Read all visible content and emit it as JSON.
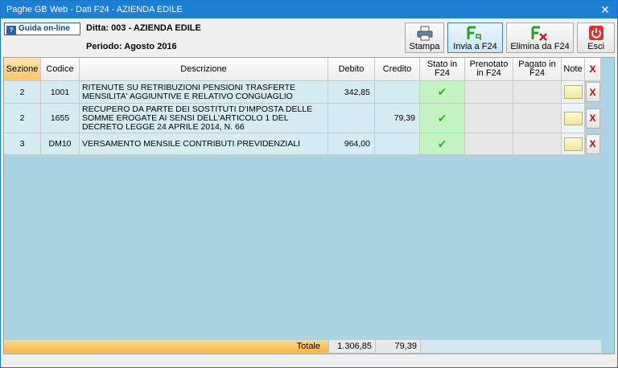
{
  "window": {
    "title": "Paghe GB Web - Dati F24 - AZIENDA EDILE",
    "close_label": "✕"
  },
  "header": {
    "guida_label": "Guida on-line",
    "ditta": "Ditta: 003 - AZIENDA EDILE",
    "periodo": "Periodo: Agosto 2016"
  },
  "toolbar": {
    "stampa": "Stampa",
    "invia": "Invia a F24",
    "elimina": "Elimina da F24",
    "esci": "Esci"
  },
  "table": {
    "columns": {
      "sezione": "Sezione",
      "codice": "Codice",
      "descrizione": "Descrizione",
      "debito": "Debito",
      "credito": "Credito",
      "stato": "Stato in F24",
      "prenotato": "Prenotato in F24",
      "pagato": "Pagato in F24",
      "note": "Note",
      "delete": "X"
    },
    "rows": [
      {
        "sezione": "2",
        "codice": "1001",
        "descrizione": "RITENUTE SU RETRIBUZIONI  PENSIONI TRASFERTE MENSILITA' AGGIUNTIVE E RELATIVO CONGUAGLIO",
        "debito": "342,85",
        "credito": "",
        "stato": "✔"
      },
      {
        "sezione": "2",
        "codice": "1655",
        "descrizione": "RECUPERO DA PARTE DEI SOSTITUTI D'IMPOSTA DELLE SOMME EROGATE AI SENSI DELL'ARTICOLO 1 DEL DECRETO LEGGE 24 APRILE 2014, N. 66",
        "debito": "",
        "credito": "79,39",
        "stato": "✔"
      },
      {
        "sezione": "3",
        "codice": "DM10",
        "descrizione": "VERSAMENTO MENSILE CONTRIBUTI PREVIDENZIALI",
        "debito": "964,00",
        "credito": "",
        "stato": "✔"
      }
    ],
    "delete_label": "X",
    "totals": {
      "label": "Totale",
      "debito": "1.306,85",
      "credito": "79,39"
    }
  },
  "colors": {
    "titlebar": "#1d7fd4",
    "grid_bg": "#aad4e2",
    "row_bg": "#d5ecf2",
    "status_ok": "#c2f3c0",
    "totale_bar": "#f6b54a"
  }
}
